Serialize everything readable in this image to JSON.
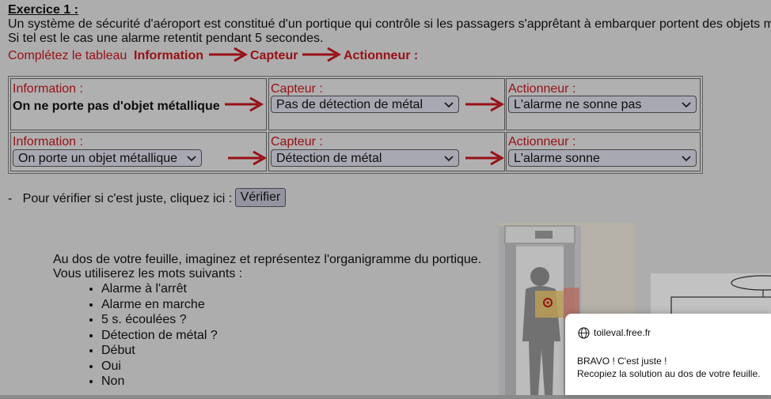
{
  "exercise": {
    "title": "Exercice 1 :",
    "line1": "Un système de sécurité d'aéroport est constitué d'un portique qui contrôle si les passagers s'apprêtant à embarquer portent des objets m",
    "line2": "Si tel est le cas une alarme retentit pendant 5 secondes.",
    "instruction": "Complétez le tableau",
    "chain": [
      "Information",
      "Capteur",
      "Actionneur :"
    ]
  },
  "table": {
    "rows": [
      {
        "info_label": "Information :",
        "info_text": "On ne porte pas d'objet métallique",
        "capteur_label": "Capteur :",
        "capteur_value": "Pas de détection de métal",
        "action_label": "Actionneur :",
        "action_value": "L'alarme ne sonne pas"
      },
      {
        "info_label": "Information :",
        "info_value": "On porte un objet métallique",
        "capteur_label": "Capteur :",
        "capteur_value": "Détection de métal",
        "action_label": "Actionneur :",
        "action_value": "L'alarme sonne"
      }
    ]
  },
  "verify": {
    "prompt": "-   Pour vérifier si c'est juste, cliquez ici :",
    "button": "Vérifier"
  },
  "organigram": {
    "line1": "Au dos de votre feuille, imaginez et représentez l'organigramme du portique.",
    "line2": "Vous utiliserez les mots suivants :",
    "words": [
      "Alarme à l'arrêt",
      "Alarme en marche",
      "5 s. écoulées ?",
      "Détection de métal ?",
      "Début",
      "Oui",
      "Non"
    ]
  },
  "notification": {
    "site": "toileval.free.fr",
    "message1": "BRAVO ! C'est juste !",
    "message2": "Recopiez la solution au dos de votre feuille."
  },
  "colors": {
    "red": "#c0141b",
    "page": "#d9d9d9",
    "select": "#d3d3df"
  }
}
